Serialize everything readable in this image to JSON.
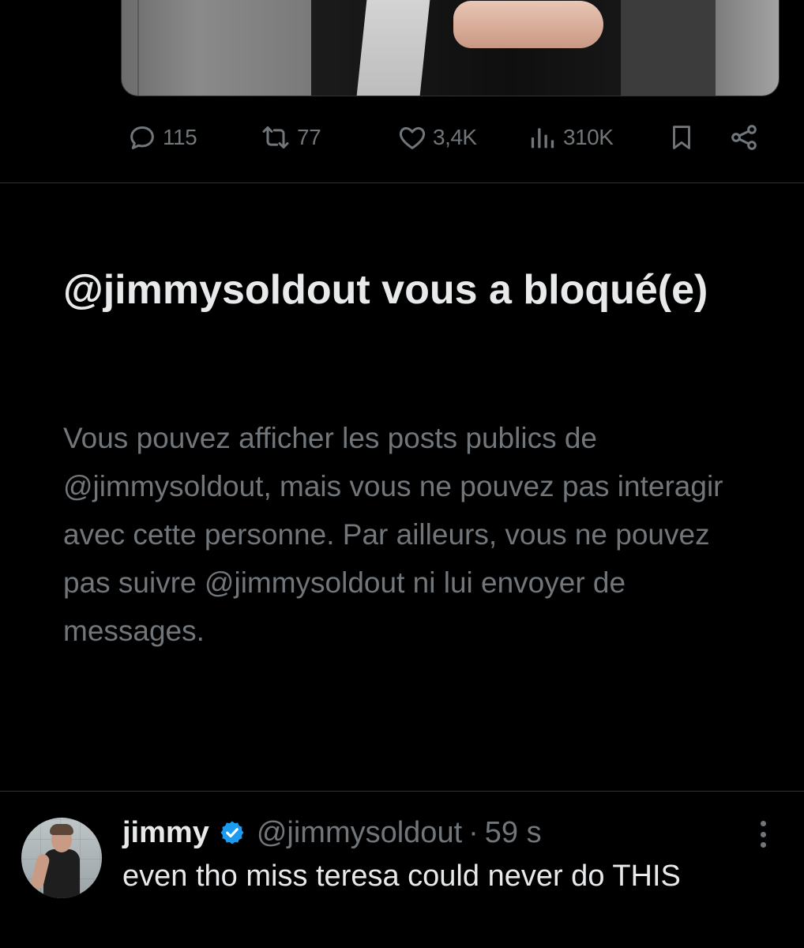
{
  "post": {
    "media_alt": "photo",
    "actions": {
      "replies": "115",
      "reposts": "77",
      "likes": "3,4K",
      "views": "310K"
    }
  },
  "blocked_notice": {
    "title": "@jimmysoldout vous a bloqué(e)",
    "body": "Vous pouvez afficher les posts publics de @jimmysoldout, mais vous ne pouvez pas interagir avec cette personne. Par ailleurs, vous ne pouvez pas suivre @jimmysoldout ni lui envoyer de messages."
  },
  "reply_tweet": {
    "name": "jimmy",
    "handle": "@jimmysoldout",
    "separator": "·",
    "time": "59 s",
    "text": "even tho miss teresa could never do THIS",
    "verified": true
  },
  "colors": {
    "background": "#000000",
    "primary_text": "#e7e9ea",
    "secondary_text": "#71767b",
    "divider": "#2f3336",
    "verified_badge": "#1d9bf0"
  },
  "icons": {
    "reply": "reply-icon",
    "repost": "repost-icon",
    "like": "heart-icon",
    "views": "views-icon",
    "bookmark": "bookmark-icon",
    "share": "share-icon",
    "verified": "verified-badge-icon",
    "more": "more-icon"
  }
}
